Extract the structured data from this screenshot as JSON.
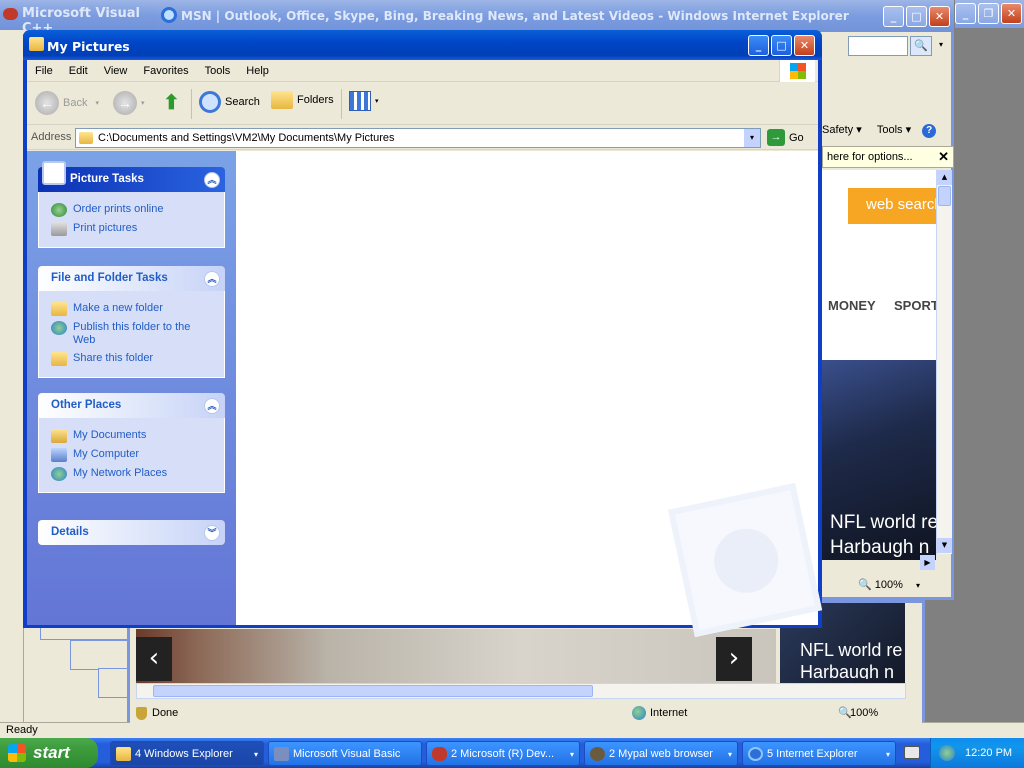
{
  "desktop": {
    "status_text": "Ready"
  },
  "vc_window": {
    "title": "Microsoft Visual C++"
  },
  "ie_window": {
    "title": "MSN | Outlook, Office, Skype, Bing, Breaking News, and Latest Videos - Windows Internet Explorer",
    "toolbar": {
      "safety": "Safety ▾",
      "tools": "Tools ▾"
    },
    "infobar": "here for options...",
    "web_search": "web search",
    "nav": {
      "money": "MONEY",
      "sports": "SPORT"
    },
    "headline": "NFL world re",
    "headline2": "Harbaugh n",
    "zoom": "100%",
    "status": {
      "done": "Done",
      "zone": "Internet",
      "zoom": "100%"
    }
  },
  "ie_back": {
    "headline": "NFL world re",
    "headline2": "Harbaugh n"
  },
  "explorer": {
    "title": "My Pictures",
    "menu": [
      "File",
      "Edit",
      "View",
      "Favorites",
      "Tools",
      "Help"
    ],
    "toolbar": {
      "back": "Back",
      "search": "Search",
      "folders": "Folders"
    },
    "address": {
      "label": "Address",
      "value": "C:\\Documents and Settings\\VM2\\My Documents\\My Pictures",
      "go": "Go"
    },
    "panels": {
      "picture_tasks": {
        "title": "Picture Tasks",
        "items": [
          "Order prints online",
          "Print pictures"
        ]
      },
      "file_tasks": {
        "title": "File and Folder Tasks",
        "items": [
          "Make a new folder",
          "Publish this folder to the Web",
          "Share this folder"
        ]
      },
      "other_places": {
        "title": "Other Places",
        "items": [
          "My Documents",
          "My Computer",
          "My Network Places"
        ]
      },
      "details": {
        "title": "Details"
      }
    }
  },
  "taskbar": {
    "start": "start",
    "items": [
      "4 Windows Explorer",
      "Microsoft Visual Basic",
      "2 Microsoft (R) Dev...",
      "2 Mypal web browser",
      "5 Internet Explorer"
    ],
    "clock": "12:20 PM"
  },
  "colors": {
    "xp_blue": "#0046c8",
    "taskbar": "#245edb",
    "task_pane": "#6b8ee0",
    "link": "#215dc6",
    "search_orange": "#f6a623"
  }
}
